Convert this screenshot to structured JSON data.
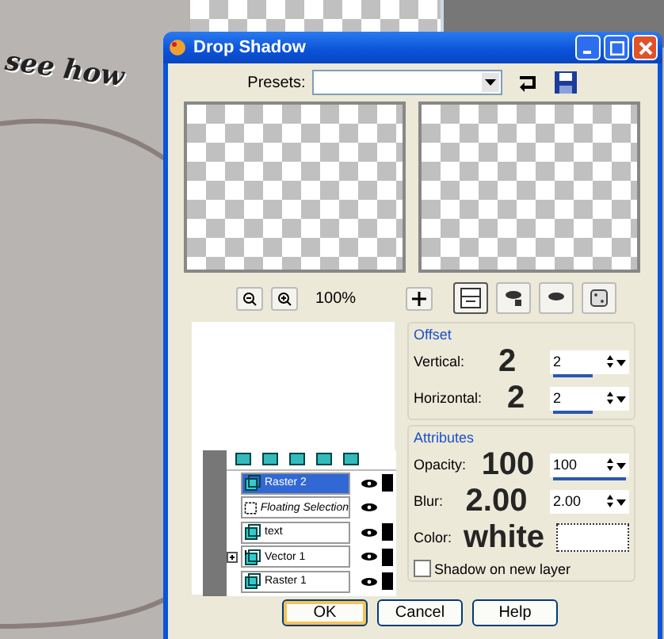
{
  "canvas": {
    "text": "see how"
  },
  "dialog": {
    "title": "Drop Shadow",
    "presets": {
      "label": "Presets:"
    },
    "zoom": "100%",
    "offset": {
      "title": "Offset",
      "fields": [
        {
          "label": "Vertical:",
          "value": "2",
          "level": 0.55
        },
        {
          "label": "Horizontal:",
          "value": "2",
          "level": 0.55
        }
      ]
    },
    "attributes": {
      "title": "Attributes",
      "fields": [
        {
          "label": "Opacity:",
          "value": "100",
          "level": 1
        },
        {
          "label": "Blur:",
          "value": "2.00"
        }
      ],
      "color_label": "Color:"
    },
    "shadow_on_new_layer": {
      "label": "Shadow on new layer",
      "checked": false
    },
    "buttons": [
      {
        "label": "OK",
        "default": true
      },
      {
        "label": "Cancel",
        "default": false
      },
      {
        "label": "Help",
        "default": false
      }
    ]
  },
  "layers": [
    {
      "name": "Raster 2",
      "kind": "raster",
      "selected": true
    },
    {
      "name": "Floating Selection",
      "kind": "selection",
      "selected": false
    },
    {
      "name": "text",
      "kind": "raster",
      "selected": false
    },
    {
      "name": "Vector 1",
      "kind": "vector",
      "selected": false
    },
    {
      "name": "Raster 1",
      "kind": "raster",
      "selected": false
    }
  ],
  "annotations": [
    "2",
    "2",
    "100",
    "2.00",
    "white"
  ]
}
